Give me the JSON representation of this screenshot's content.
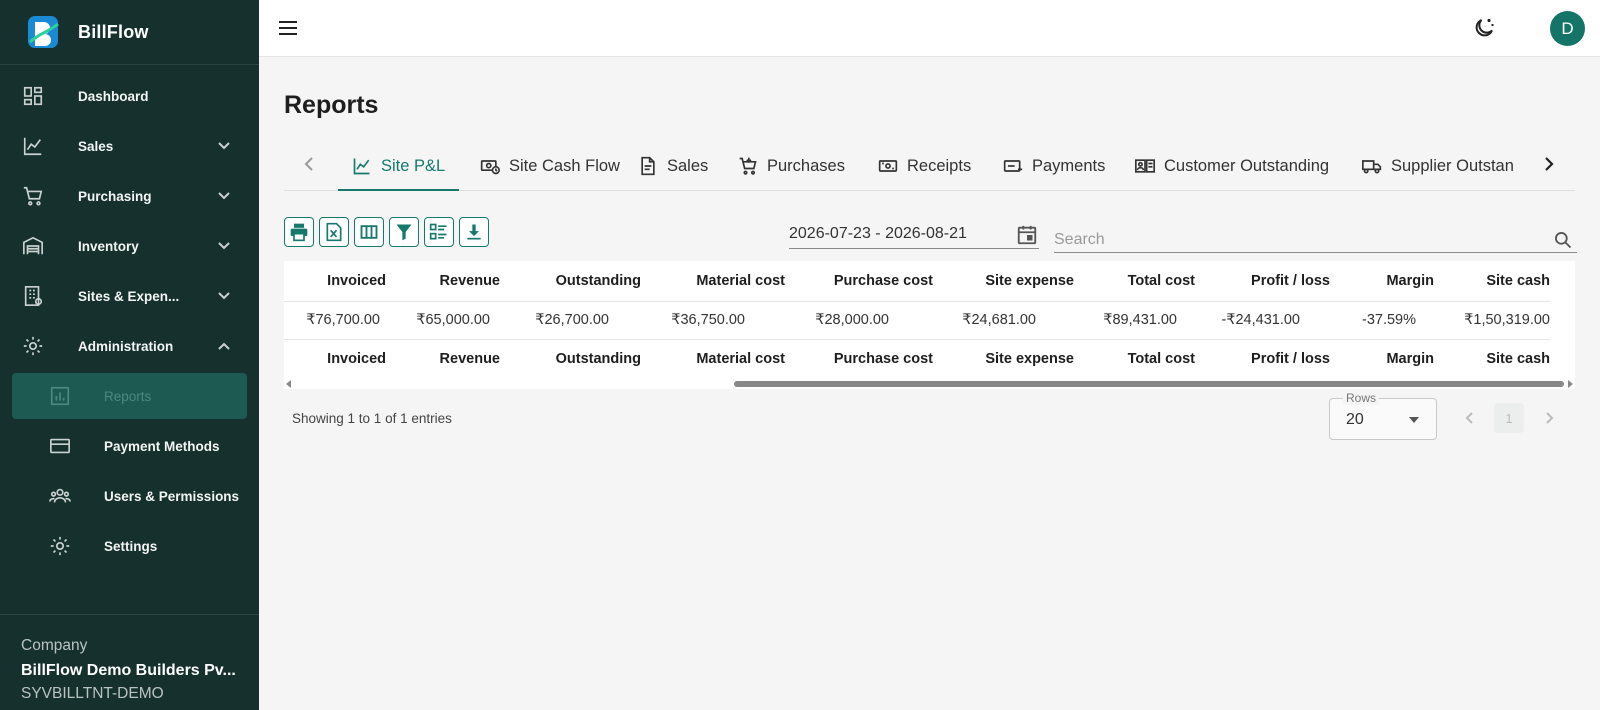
{
  "app": {
    "name": "BillFlow"
  },
  "colors": {
    "sidebar": "#16302d",
    "accent": "#157a6c",
    "avatar": "#137467"
  },
  "sidebar": {
    "items": [
      {
        "label": "Dashboard",
        "icon": "dashboard-icon"
      },
      {
        "label": "Sales",
        "icon": "chart-line-icon"
      },
      {
        "label": "Purchasing",
        "icon": "cart-icon"
      },
      {
        "label": "Inventory",
        "icon": "warehouse-icon"
      },
      {
        "label": "Sites & Expen...",
        "icon": "building-icon"
      },
      {
        "label": "Administration",
        "icon": "gear-icon"
      }
    ],
    "sub_items": [
      {
        "label": "Reports",
        "icon": "bar-chart-icon"
      },
      {
        "label": "Payment Methods",
        "icon": "credit-card-icon"
      },
      {
        "label": "Users & Permissions",
        "icon": "users-icon"
      },
      {
        "label": "Settings",
        "icon": "gear-icon"
      }
    ],
    "company": {
      "label": "Company",
      "name": "BillFlow Demo Builders Pv...",
      "code": "SYVBILLTNT-DEMO"
    }
  },
  "topbar": {
    "avatar_letter": "D"
  },
  "page": {
    "title": "Reports"
  },
  "tabs": [
    {
      "label": "Site P&L",
      "icon": "chart-line-icon",
      "active": true
    },
    {
      "label": "Site Cash Flow",
      "icon": "cash-flow-icon"
    },
    {
      "label": "Sales",
      "icon": "document-icon"
    },
    {
      "label": "Purchases",
      "icon": "cart-icon"
    },
    {
      "label": "Receipts",
      "icon": "receipt-icon"
    },
    {
      "label": "Payments",
      "icon": "payment-icon"
    },
    {
      "label": "Customer Outstanding",
      "icon": "customer-icon"
    },
    {
      "label": "Supplier Outstan",
      "icon": "truck-icon"
    }
  ],
  "filters": {
    "date_range": "2026-07-23 - 2026-08-21",
    "search_placeholder": "Search"
  },
  "table": {
    "columns": [
      "Invoiced",
      "Revenue",
      "Outstanding",
      "Material cost",
      "Purchase cost",
      "Site expense",
      "Total cost",
      "Profit / loss",
      "Margin",
      "Site cash"
    ],
    "rows": [
      [
        "₹76,700.00",
        "₹65,000.00",
        "₹26,700.00",
        "₹36,750.00",
        "₹28,000.00",
        "₹24,681.00",
        "₹89,431.00",
        "-₹24,431.00",
        "-37.59%",
        "₹1,50,319.00"
      ]
    ]
  },
  "footer": {
    "entries_text": "Showing 1 to 1 of 1 entries",
    "rows_label": "Rows",
    "rows_value": "20",
    "current_page": "1"
  }
}
